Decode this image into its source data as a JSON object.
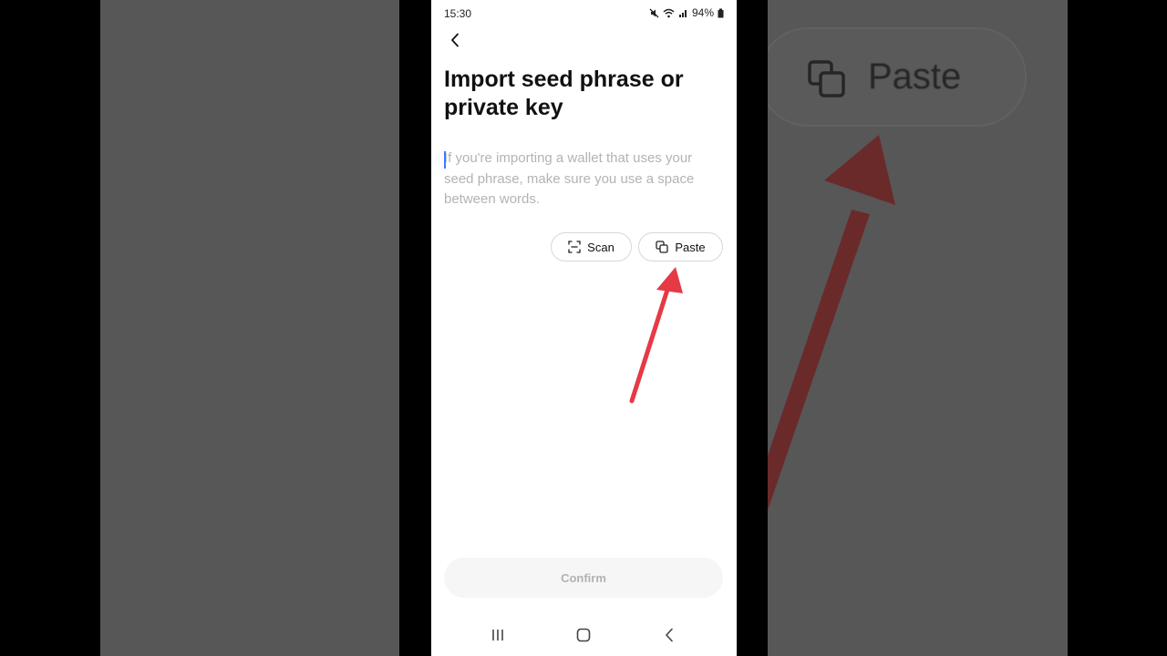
{
  "status_bar": {
    "time": "15:30",
    "battery": "94%"
  },
  "header": {
    "title": "Import seed phrase or private key"
  },
  "seed_input": {
    "value": "",
    "placeholder": "If you're importing a wallet that uses your seed phrase, make sure you use a space between words."
  },
  "actions": {
    "scan_label": "Scan",
    "paste_label": "Paste"
  },
  "footer": {
    "confirm_label": "Confirm"
  },
  "zoom_panel": {
    "paste_label": "Paste"
  },
  "colors": {
    "annotation_arrow": "#e63946",
    "caret": "#3d7bff",
    "confirm_text": "#b2b2b2"
  },
  "icons": [
    "chevron-left-icon",
    "scan-icon",
    "copy-icon",
    "mute-icon",
    "wifi-icon",
    "signal-icon",
    "battery-icon",
    "recents-icon",
    "home-icon",
    "back-nav-icon"
  ]
}
